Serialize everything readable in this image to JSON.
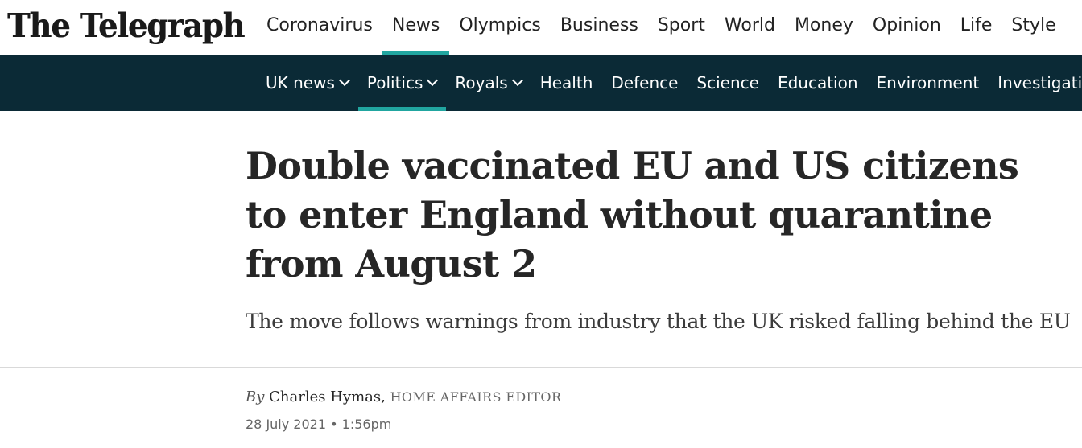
{
  "header": {
    "logo_text": "The Telegraph",
    "primary_nav": [
      {
        "label": "Coronavirus"
      },
      {
        "label": "News"
      },
      {
        "label": "Olympics"
      },
      {
        "label": "Business"
      },
      {
        "label": "Sport"
      },
      {
        "label": "World"
      },
      {
        "label": "Money"
      },
      {
        "label": "Opinion"
      },
      {
        "label": "Life"
      },
      {
        "label": "Style"
      }
    ],
    "primary_active": "News",
    "accent_color": "#21a6a0"
  },
  "subnav": {
    "background_color": "#0b2a36",
    "items": [
      {
        "label": "UK news"
      },
      {
        "label": "Politics"
      },
      {
        "label": "Royals"
      },
      {
        "label": "Health"
      },
      {
        "label": "Defence"
      },
      {
        "label": "Science"
      },
      {
        "label": "Education"
      },
      {
        "label": "Environment"
      },
      {
        "label": "Investigations"
      }
    ],
    "active": "Politics",
    "dropdown_icons": [
      "chevron-down-icon",
      "chevron-down-icon",
      "chevron-down-icon"
    ]
  },
  "article": {
    "headline": "Double vaccinated EU and US citizens to enter England without quarantine from August 2",
    "standfirst": "The move follows warnings from industry that the UK risked falling behind the EU",
    "byline": {
      "by": "By",
      "author": "Charles Hymas,",
      "role": "HOME AFFAIRS EDITOR"
    },
    "date": "28 July 2021 • 1:56pm"
  }
}
